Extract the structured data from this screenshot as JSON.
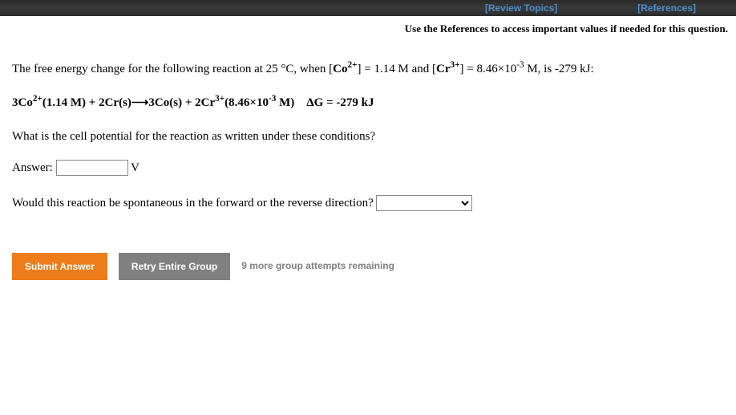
{
  "topbar": {
    "review": "[Review Topics]",
    "references": "[References]"
  },
  "instruction": "Use the References to access important values if needed for this question.",
  "intro": {
    "pre": "The free energy change for the following reaction at 25 °C, when [",
    "co": "Co",
    "co_sup": "2+",
    "mid1": "] = 1.14 M and [",
    "cr": "Cr",
    "cr_sup": "3+",
    "mid2": "] = 8.46×10",
    "exp": "-3",
    "post": " M, is -279 kJ:"
  },
  "equation": {
    "coef1": "3Co",
    "sup1": "2+",
    "part1": "(1.14 M) + 2Cr(s)",
    "arrow": "⟶",
    "part2": "3Co(s) + 2Cr",
    "sup2": "3+",
    "part3": "(8.46×10",
    "sup3": "-3",
    "part4": " M)    ΔG = -279 kJ"
  },
  "question1": "What is the cell potential for the reaction as written under these conditions?",
  "answer_label": "Answer:",
  "unit": "V",
  "answer_value": "",
  "question2": "Would this reaction be spontaneous in the forward or the reverse direction?",
  "buttons": {
    "submit": "Submit Answer",
    "retry": "Retry Entire Group"
  },
  "attempts": "9 more group attempts remaining"
}
